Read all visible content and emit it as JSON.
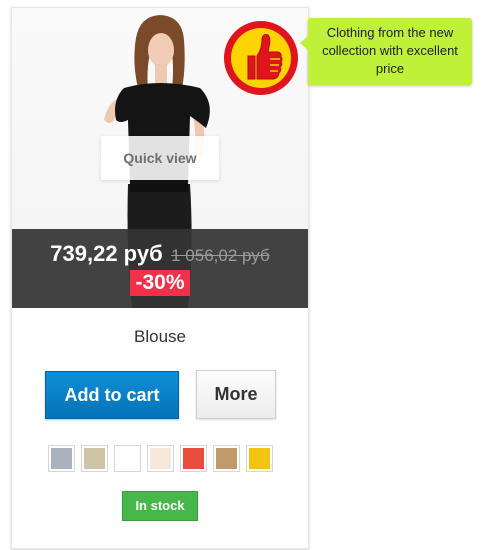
{
  "product": {
    "name": "Blouse",
    "price_current": "739,22 руб",
    "price_old": "1 056,02 руб",
    "discount": "-30%",
    "stock_label": "In stock"
  },
  "actions": {
    "quick_view_label": "Quick view",
    "add_to_cart_label": "Add to cart",
    "more_label": "More"
  },
  "badge": {
    "icon": "thumbs-up-icon",
    "tooltip_text": "Clothing from the new collection with excellent price"
  },
  "colors": {
    "accent_blue": "#0a83cc",
    "price_bar": "#343434",
    "discount": "#f1314a",
    "stock": "#46b748",
    "tooltip": "#bef137",
    "badge_red": "#e0141c",
    "badge_yellow": "#ffd400"
  },
  "swatches": [
    {
      "name": "grey",
      "color": "#aab2bd"
    },
    {
      "name": "taupe",
      "color": "#cfc4a6"
    },
    {
      "name": "white",
      "color": "#ffffff"
    },
    {
      "name": "beige",
      "color": "#f5e9d9"
    },
    {
      "name": "red",
      "color": "#e84c3d"
    },
    {
      "name": "camel",
      "color": "#c19a6b"
    },
    {
      "name": "yellow",
      "color": "#f1c40f"
    }
  ]
}
